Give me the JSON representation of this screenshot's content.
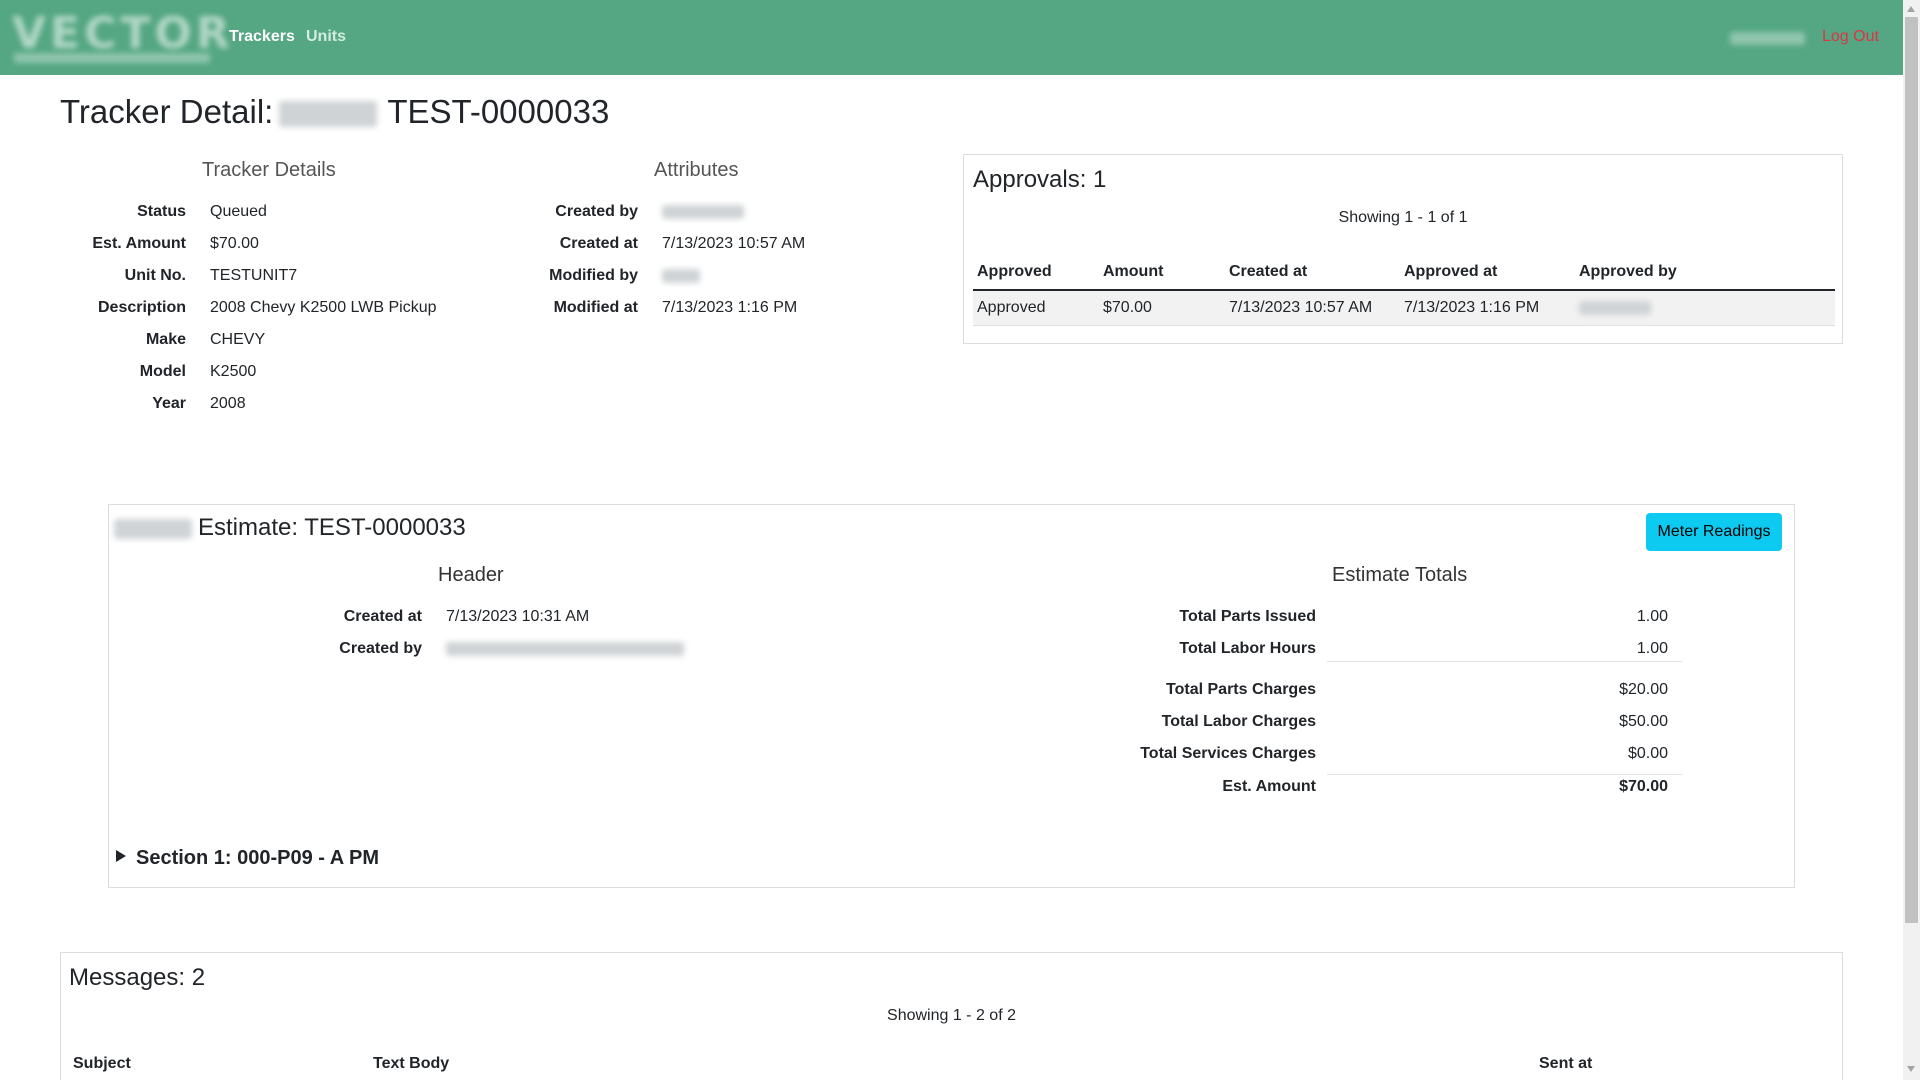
{
  "nav": {
    "logo": "VECTOR",
    "links": {
      "trackers": "Trackers",
      "units": "Units",
      "logout": "Log Out"
    }
  },
  "page": {
    "title_prefix": "Tracker Detail:",
    "title_id": "TEST-0000033"
  },
  "tracker_details": {
    "heading": "Tracker Details",
    "rows": [
      {
        "label": "Status",
        "value": "Queued"
      },
      {
        "label": "Est. Amount",
        "value": "$70.00"
      },
      {
        "label": "Unit No.",
        "value": "TESTUNIT7"
      },
      {
        "label": "Description",
        "value": "2008 Chevy K2500 LWB Pickup"
      },
      {
        "label": "Make",
        "value": "CHEVY"
      },
      {
        "label": "Model",
        "value": "K2500"
      },
      {
        "label": "Year",
        "value": "2008"
      }
    ]
  },
  "attributes": {
    "heading": "Attributes",
    "rows": [
      {
        "label": "Created by",
        "value": ""
      },
      {
        "label": "Created at",
        "value": "7/13/2023 10:57 AM"
      },
      {
        "label": "Modified by",
        "value": ""
      },
      {
        "label": "Modified at",
        "value": "7/13/2023 1:16 PM"
      }
    ]
  },
  "approvals": {
    "title": "Approvals: 1",
    "showing": "Showing 1 - 1 of 1",
    "columns": [
      "Approved",
      "Amount",
      "Created at",
      "Approved at",
      "Approved by"
    ],
    "rows": [
      [
        "Approved",
        "$70.00",
        "7/13/2023 10:57 AM",
        "7/13/2023 1:16 PM",
        ""
      ]
    ]
  },
  "estimate": {
    "title": "Estimate: TEST-0000033",
    "meter_button": "Meter Readings",
    "header": {
      "heading": "Header",
      "rows": [
        {
          "label": "Created at",
          "value": "7/13/2023 10:31 AM"
        },
        {
          "label": "Created by",
          "value": ""
        }
      ]
    },
    "totals": {
      "heading": "Estimate Totals",
      "rows": [
        {
          "label": "Total Parts Issued",
          "value": "1.00"
        },
        {
          "label": "Total Labor Hours",
          "value": "1.00"
        },
        {
          "label": "Total Parts Charges",
          "value": "$20.00"
        },
        {
          "label": "Total Labor Charges",
          "value": "$50.00"
        },
        {
          "label": "Total Services Charges",
          "value": "$0.00"
        },
        {
          "label": "Est. Amount",
          "value": "$70.00"
        }
      ]
    },
    "section": "Section 1: 000-P09 - A PM"
  },
  "messages": {
    "title": "Messages: 2",
    "showing": "Showing 1 - 2 of 2",
    "columns": [
      "Subject",
      "Text Body",
      "Sent at"
    ]
  }
}
